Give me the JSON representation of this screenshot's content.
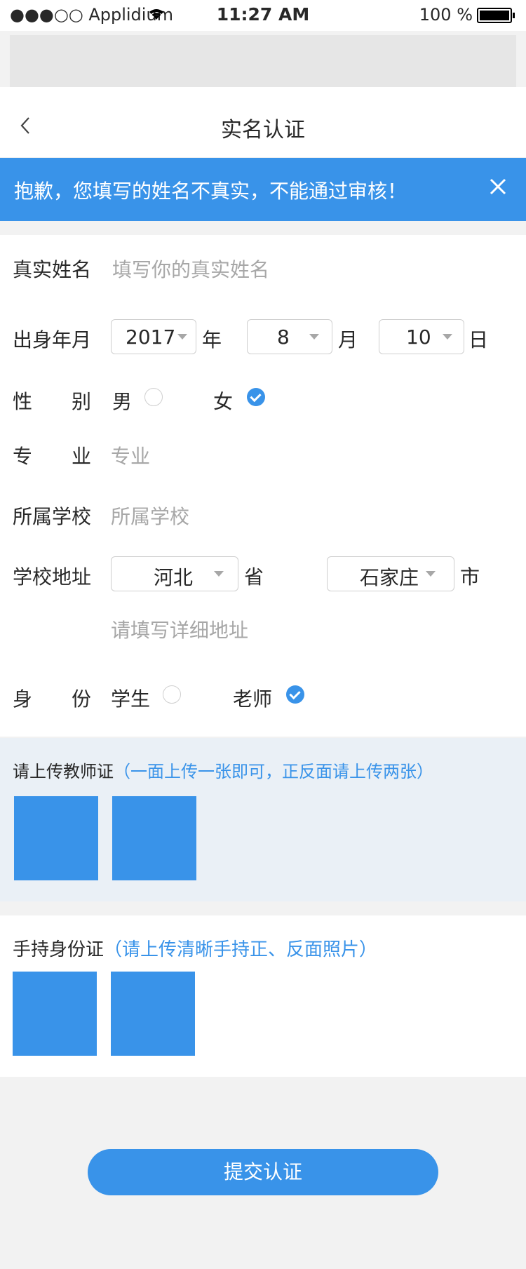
{
  "status_bar": {
    "carrier": "●●●○○ Applidium",
    "time": "11:27 AM",
    "battery": "100 %"
  },
  "nav": {
    "title": "实名认证",
    "back_icon": "chevron-left-icon"
  },
  "banner": {
    "message": "抱歉，您填写的姓名不真实，不能通过审核！",
    "close_icon": "close-icon",
    "background": "#3993e9"
  },
  "form": {
    "name": {
      "label": "真实姓名",
      "placeholder": "填写你的真实姓名"
    },
    "birth": {
      "label": "出身年月",
      "year": "2017",
      "year_unit": "年",
      "month": "8",
      "month_unit": "月",
      "day": "10",
      "day_unit": "日"
    },
    "gender": {
      "label": "性　　别",
      "male": "男",
      "female": "女",
      "selected": "female"
    },
    "major": {
      "label": "专　　业",
      "placeholder": "专业"
    },
    "school": {
      "label": "所属学校",
      "placeholder": "所属学校"
    },
    "address": {
      "label": "学校地址",
      "province": "河北",
      "province_unit": "省",
      "city": "石家庄",
      "city_unit": "市",
      "detail_placeholder": "请填写详细地址"
    },
    "identity": {
      "label": "身　　份",
      "student": "学生",
      "teacher": "老师",
      "selected": "teacher"
    }
  },
  "teacher_cert": {
    "title": "请上传教师证",
    "note": "（一面上传一张即可，正反面请上传两张）"
  },
  "id_card": {
    "title": "手持身份证",
    "note": "（请上传清晰手持正、反面照片）"
  },
  "submit": {
    "label": "提交认证"
  },
  "colors": {
    "accent": "#3993e9",
    "text": "#282828",
    "placeholder": "#a7a7a7"
  }
}
